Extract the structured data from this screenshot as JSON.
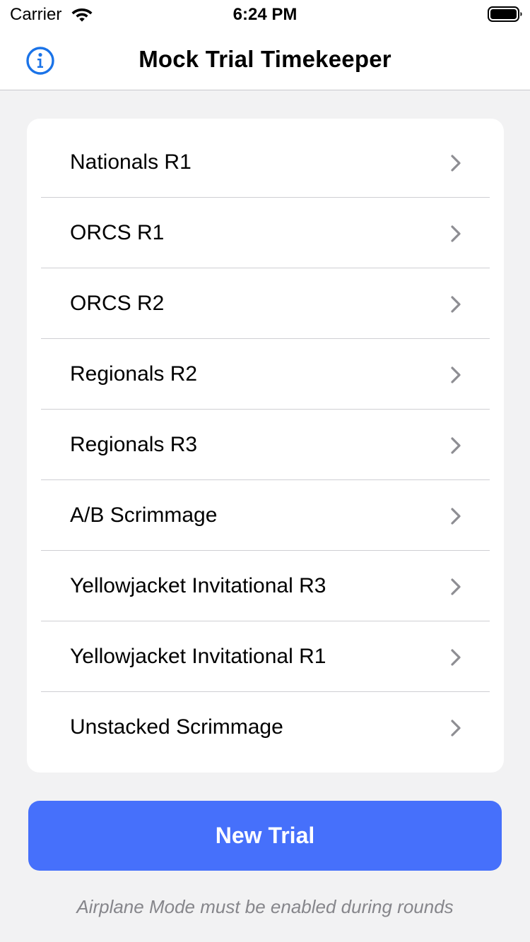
{
  "status_bar": {
    "carrier": "Carrier",
    "time": "6:24 PM",
    "wifi_icon": "wifi-icon",
    "battery_icon": "battery-full-icon"
  },
  "nav": {
    "title": "Mock Trial Timekeeper",
    "info_icon": "info-circle-icon",
    "accent_color": "#1a73e8"
  },
  "trials": [
    {
      "label": "Nationals R1"
    },
    {
      "label": "ORCS R1"
    },
    {
      "label": "ORCS R2"
    },
    {
      "label": "Regionals R2"
    },
    {
      "label": "Regionals R3"
    },
    {
      "label": "A/B Scrimmage"
    },
    {
      "label": "Yellowjacket Invitational R3"
    },
    {
      "label": "Yellowjacket Invitational R1"
    },
    {
      "label": "Unstacked Scrimmage"
    }
  ],
  "new_trial_button": {
    "label": "New Trial",
    "color": "#4670fb"
  },
  "footer": {
    "note": "Airplane Mode must be enabled during rounds"
  },
  "colors": {
    "background": "#f2f2f3",
    "card": "#ffffff",
    "chevron": "#8e8e93",
    "footer_text": "#86868b"
  }
}
